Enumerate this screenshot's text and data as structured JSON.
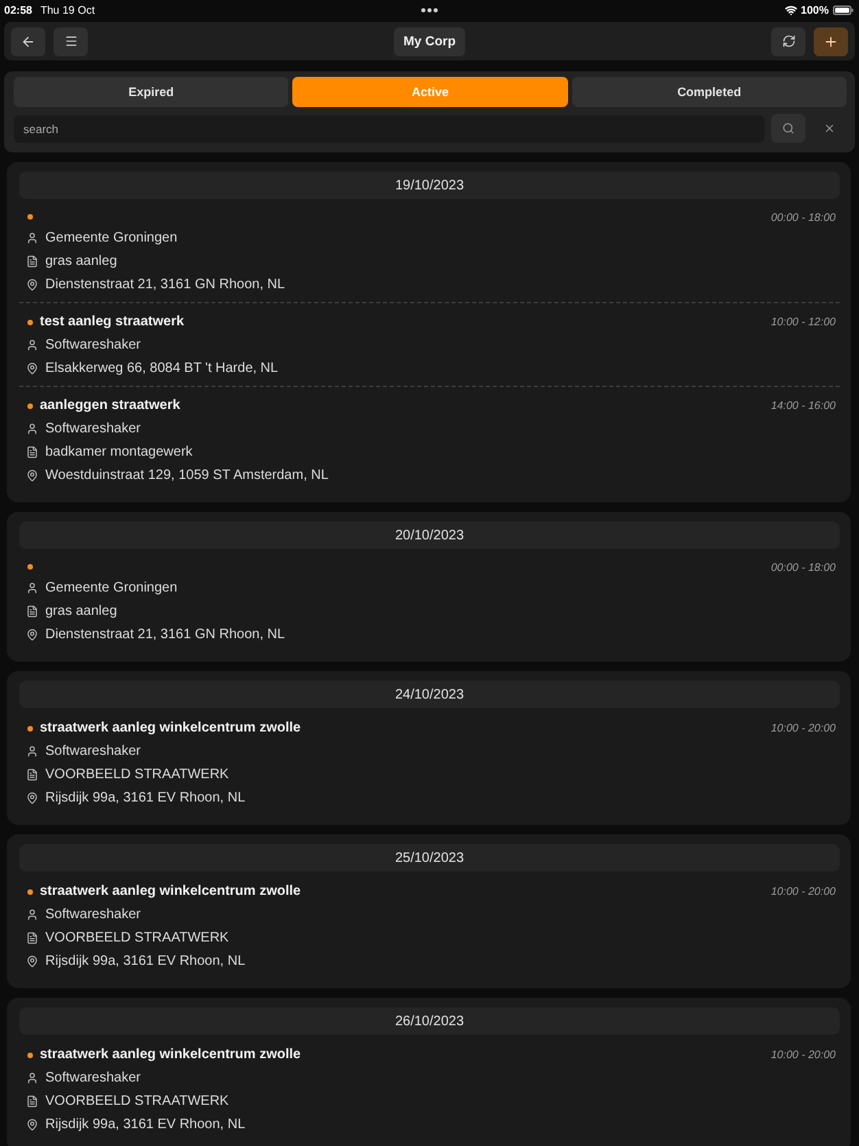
{
  "status_bar": {
    "time": "02:58",
    "date": "Thu 19 Oct",
    "battery": "100%"
  },
  "header": {
    "title": "My Corp"
  },
  "tabs": [
    {
      "label": "Expired",
      "selected": false
    },
    {
      "label": "Active",
      "selected": true
    },
    {
      "label": "Completed",
      "selected": false
    }
  ],
  "search": {
    "placeholder": "search"
  },
  "days": [
    {
      "date": "19/10/2023",
      "appointments": [
        {
          "time": "00:00 - 18:00",
          "details": [
            {
              "kind": "person",
              "text": "Gemeente Groningen"
            },
            {
              "kind": "document",
              "text": "gras aanleg"
            },
            {
              "kind": "location",
              "text": "Dienstenstraat 21, 3161 GN Rhoon, NL"
            }
          ]
        },
        {
          "title": "test aanleg straatwerk",
          "time": "10:00 - 12:00",
          "details": [
            {
              "kind": "person",
              "text": "Softwareshaker"
            },
            {
              "kind": "location",
              "text": "Elsakkerweg 66, 8084 BT 't Harde, NL"
            }
          ]
        },
        {
          "title": "aanleggen straatwerk",
          "time": "14:00 - 16:00",
          "details": [
            {
              "kind": "person",
              "text": "Softwareshaker"
            },
            {
              "kind": "document",
              "text": "badkamer montagewerk"
            },
            {
              "kind": "location",
              "text": "Woestduinstraat 129, 1059 ST Amsterdam, NL"
            }
          ]
        }
      ]
    },
    {
      "date": "20/10/2023",
      "appointments": [
        {
          "time": "00:00 - 18:00",
          "details": [
            {
              "kind": "person",
              "text": "Gemeente Groningen"
            },
            {
              "kind": "document",
              "text": "gras aanleg"
            },
            {
              "kind": "location",
              "text": "Dienstenstraat 21, 3161 GN Rhoon, NL"
            }
          ]
        }
      ]
    },
    {
      "date": "24/10/2023",
      "appointments": [
        {
          "title": "straatwerk aanleg winkelcentrum zwolle",
          "time": "10:00 - 20:00",
          "details": [
            {
              "kind": "person",
              "text": "Softwareshaker"
            },
            {
              "kind": "document",
              "text": "VOORBEELD STRAATWERK"
            },
            {
              "kind": "location",
              "text": "Rijsdijk 99a, 3161 EV Rhoon, NL"
            }
          ]
        }
      ]
    },
    {
      "date": "25/10/2023",
      "appointments": [
        {
          "title": "straatwerk aanleg winkelcentrum zwolle",
          "time": "10:00 - 20:00",
          "details": [
            {
              "kind": "person",
              "text": "Softwareshaker"
            },
            {
              "kind": "document",
              "text": "VOORBEELD STRAATWERK"
            },
            {
              "kind": "location",
              "text": "Rijsdijk 99a, 3161 EV Rhoon, NL"
            }
          ]
        }
      ]
    },
    {
      "date": "26/10/2023",
      "appointments": [
        {
          "title": "straatwerk aanleg winkelcentrum zwolle",
          "time": "10:00 - 20:00",
          "details": [
            {
              "kind": "person",
              "text": "Softwareshaker"
            },
            {
              "kind": "document",
              "text": "VOORBEELD STRAATWERK"
            },
            {
              "kind": "location",
              "text": "Rijsdijk 99a, 3161 EV Rhoon, NL"
            }
          ]
        }
      ]
    }
  ]
}
